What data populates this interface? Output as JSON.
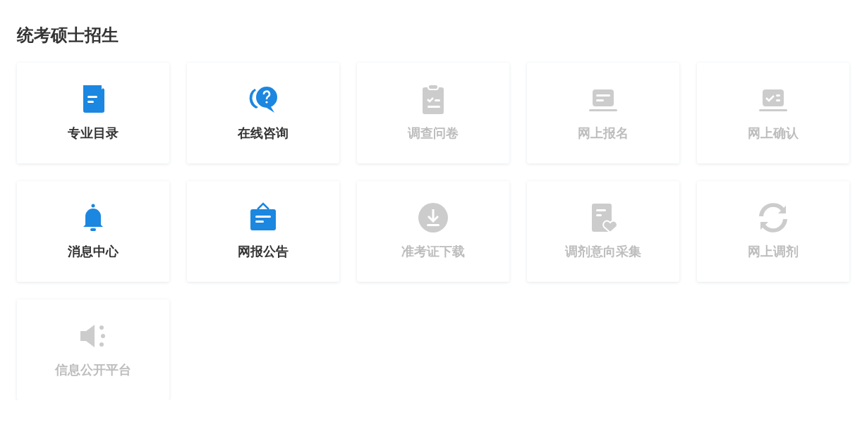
{
  "section": {
    "title": "统考硕士招生"
  },
  "cards": [
    {
      "label": "专业目录",
      "kind": "document",
      "disabled": false
    },
    {
      "label": "在线咨询",
      "kind": "question",
      "disabled": false
    },
    {
      "label": "调查问卷",
      "kind": "clipboard",
      "disabled": true
    },
    {
      "label": "网上报名",
      "kind": "laptop",
      "disabled": true
    },
    {
      "label": "网上确认",
      "kind": "laptop-check",
      "disabled": true
    },
    {
      "label": "消息中心",
      "kind": "bell",
      "disabled": false
    },
    {
      "label": "网报公告",
      "kind": "notice",
      "disabled": false
    },
    {
      "label": "准考证下载",
      "kind": "download",
      "disabled": true
    },
    {
      "label": "调剂意向采集",
      "kind": "doc-heart",
      "disabled": true
    },
    {
      "label": "网上调剂",
      "kind": "refresh",
      "disabled": true
    },
    {
      "label": "信息公开平台",
      "kind": "speaker",
      "disabled": true
    }
  ]
}
